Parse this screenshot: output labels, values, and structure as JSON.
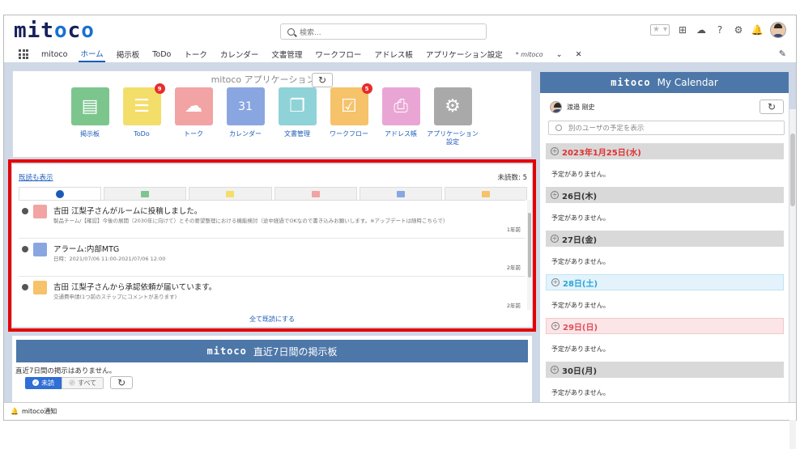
{
  "header": {
    "logo_text": "mitoco",
    "search_placeholder": "検索...",
    "nav": {
      "app_name": "mitoco",
      "items": [
        "ホーム",
        "掲示板",
        "ToDo",
        "トーク",
        "カレンダー",
        "文書管理",
        "ワークフロー",
        "アドレス帳",
        "アプリケーション設定"
      ],
      "current_tab": "* mitoco"
    }
  },
  "apps": {
    "title": "mitoco アプリケーション一覧",
    "items": [
      {
        "label": "掲示板",
        "color": "#7cc68e",
        "badge": ""
      },
      {
        "label": "ToDo",
        "color": "#f4de6a",
        "badge": "9"
      },
      {
        "label": "トーク",
        "color": "#f2a3a3",
        "badge": ""
      },
      {
        "label": "カレンダー",
        "color": "#8aa6e0",
        "badge": ""
      },
      {
        "label": "文書管理",
        "color": "#8fd3d8",
        "badge": ""
      },
      {
        "label": "ワークフロー",
        "color": "#f6c26a",
        "badge": "5"
      },
      {
        "label": "アドレス帳",
        "color": "#e9a6d5",
        "badge": ""
      },
      {
        "label": "アプリケーション",
        "label2": "設定",
        "color": "#a9a9a9",
        "badge": ""
      }
    ]
  },
  "notifications": {
    "show_read": "既読も表示",
    "unread_count": "未読数: 5",
    "items": [
      {
        "title": "吉田 江梨子さんがルームに投稿しました。",
        "sub": "製品チーム/【確認】今後の展開（2030年に向けて）とその要望整理における機能検討（途中経過でOKなので書き込みお願いします。※アップデートは随時こちらで）",
        "time": "1年前",
        "color": "#f2a3a3"
      },
      {
        "title": "アラーム:内部MTG",
        "sub": "日時：2021/07/06 11:00-2021/07/06 12:00",
        "time": "2年前",
        "color": "#8aa6e0"
      },
      {
        "title": "吉田 江梨子さんから承認依頼が届いています。",
        "sub": "交通費申請(1つ前のステップにコメントがあります)",
        "time": "2年前",
        "color": "#f6c26a"
      }
    ],
    "mark_all_read": "全て既読にする"
  },
  "board": {
    "brand": "mitoco",
    "title": "直近7日間の掲示板",
    "empty": "直近7日間の掲示はありません。",
    "unread_label": "未読",
    "all_label": "すべて"
  },
  "calendar": {
    "brand": "mitoco",
    "title": "My Calendar",
    "user": "渡邉 剛史",
    "search_placeholder": "別のユーザの予定を表示",
    "days": [
      {
        "label": "2023年1月25日(水)",
        "kind": "red"
      },
      {
        "label": "26日(木)",
        "kind": ""
      },
      {
        "label": "27日(金)",
        "kind": ""
      },
      {
        "label": "28日(土)",
        "kind": "sat"
      },
      {
        "label": "29日(日)",
        "kind": "sun"
      },
      {
        "label": "30日(月)",
        "kind": ""
      }
    ],
    "no_plan": "予定がありません。"
  },
  "footer": {
    "label": "mitoco通知"
  }
}
